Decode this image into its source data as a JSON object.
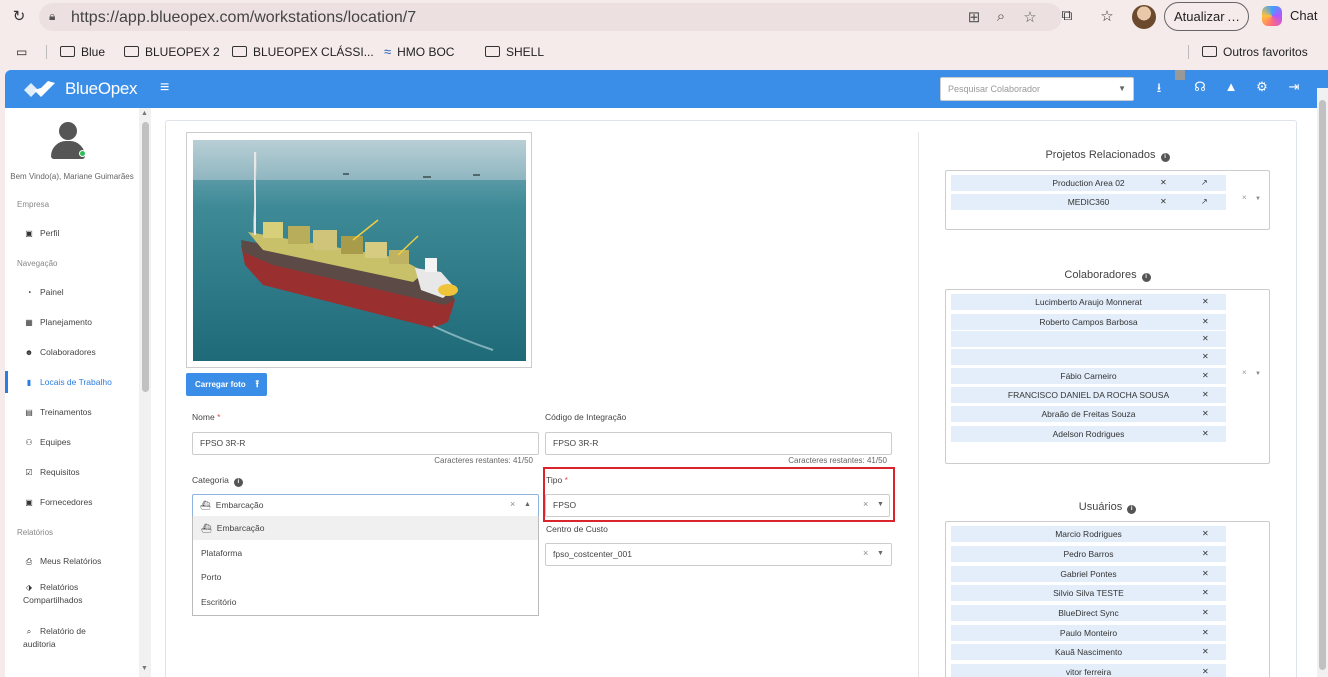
{
  "browser": {
    "url": "https://app.blueopex.com/workstations/location/7",
    "update_label": "Atualizar",
    "update_more": "…",
    "chat_label": "Chat",
    "bookmarks": [
      "Blue",
      "BLUEOPEX 2",
      "BLUEOPEX CLÁSSI...",
      "HMO BOC",
      "SHELL"
    ],
    "other_favorites": "Outros favoritos"
  },
  "header": {
    "logo_text": "BlueOpex",
    "search_placeholder": "Pesquisar Colaborador",
    "brand_color": "#3b8ee8"
  },
  "sidebar": {
    "welcome": "Bem Vindo(a), Mariane Guimarães",
    "section_empresa": "Empresa",
    "section_navegacao": "Navegação",
    "section_relatorios": "Relatórios",
    "perfil": "Perfil",
    "items": [
      "Painel",
      "Planejamento",
      "Colaboradores",
      "Locais de Trabalho",
      "Treinamentos",
      "Equipes",
      "Requisitos",
      "Fornecedores"
    ],
    "reports": [
      "Meus Relatórios",
      "Relatórios",
      "Compartilhados",
      "Relatório de",
      "auditoria"
    ]
  },
  "form": {
    "upload_label": "Carregar foto",
    "nome_label": "Nome",
    "nome_value": "FPSO 3R-R",
    "nome_counter": "Caracteres restantes: 41/50",
    "codigo_label": "Código de Integração",
    "codigo_value": "FPSO 3R-R",
    "codigo_counter": "Caracteres restantes: 41/50",
    "categoria_label": "Categoria",
    "categoria_value": "Embarcação",
    "categoria_options": [
      "Embarcação",
      "Plataforma",
      "Porto",
      "Escritório"
    ],
    "tipo_label": "Tipo",
    "tipo_value": "FPSO",
    "centro_label": "Centro de Custo",
    "centro_value": "fpso_costcenter_001",
    "required_mark": "*"
  },
  "projetos": {
    "title": "Projetos Relacionados",
    "items": [
      "Production Area 02",
      "MEDIC360"
    ]
  },
  "colaboradores": {
    "title": "Colaboradores",
    "items": [
      "Lucimberto Araujo Monnerat",
      "Roberto Campos Barbosa",
      "",
      "",
      "Fábio Carneiro",
      "FRANCISCO DANIEL DA ROCHA SOUSA",
      "Abraão de Freitas Souza",
      "Adelson Rodrigues"
    ]
  },
  "usuarios": {
    "title": "Usuários",
    "items": [
      "Marcio Rodrigues",
      "Pedro Barros",
      "Gabriel Pontes",
      "Silvio Silva TESTE",
      "BlueDirect Sync",
      "Paulo Monteiro",
      "Kauã Nascimento",
      "vitor ferreira"
    ]
  }
}
